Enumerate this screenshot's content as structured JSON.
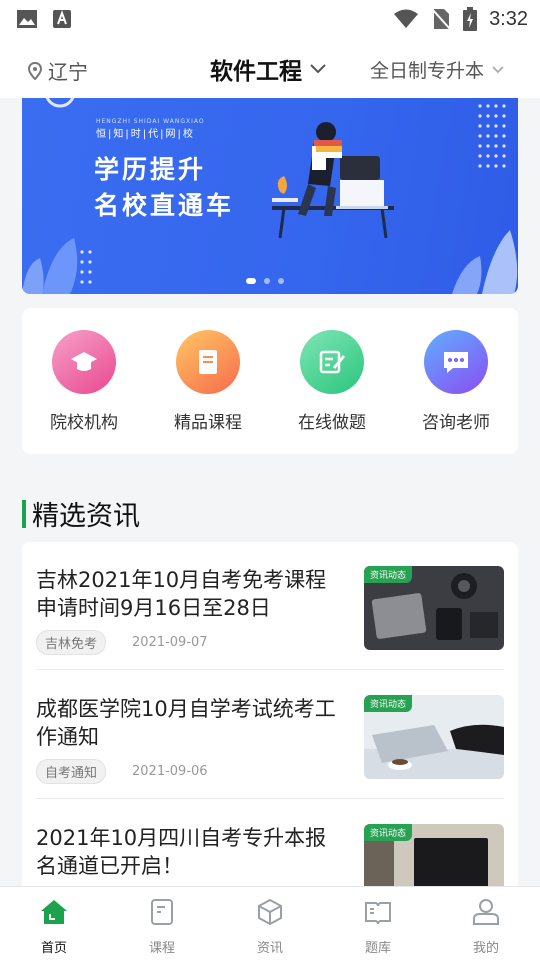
{
  "status": {
    "time": "3:32"
  },
  "header": {
    "location": "辽宁",
    "major": "软件工程",
    "education": "全日制专升本"
  },
  "banner": {
    "brand_en": "HENGZHI SHIDAI WANGXIAO",
    "brand": "恒|知|时|代|网|校",
    "title": "学历提升",
    "subtitle": "名校直通车",
    "page_count": 3,
    "active_page": 0
  },
  "quick_links": [
    {
      "label": "院校机构",
      "icon": "graduation-cap-icon",
      "color_from": "#f6a1c9",
      "color_to": "#e9488f"
    },
    {
      "label": "精品课程",
      "icon": "book-icon",
      "color_from": "#ffc765",
      "color_to": "#f66b4b"
    },
    {
      "label": "在线做题",
      "icon": "edit-note-icon",
      "color_from": "#7fe6b4",
      "color_to": "#2bc47d"
    },
    {
      "label": "咨询老师",
      "icon": "chat-icon",
      "color_from": "#5fb0ff",
      "color_to": "#8b4cf2"
    }
  ],
  "section": {
    "title": "精选资讯"
  },
  "news": [
    {
      "title": "吉林2021年10月自考免考课程申请时间9月16日至28日",
      "tag": "吉林免考",
      "date": "2021-09-07",
      "badge": "资讯动态",
      "thumb": "camera-desk-photo"
    },
    {
      "title": "成都医学院10月自学考试统考工作通知",
      "tag": "自考通知",
      "date": "2021-09-06",
      "badge": "资讯动态",
      "thumb": "laptop-coffee-photo"
    },
    {
      "title": "2021年10月四川自考专升本报名通道已开启！",
      "tag": "",
      "date": "",
      "badge": "资讯动态",
      "thumb": "office-monitor-photo"
    }
  ],
  "tabs": [
    {
      "label": "首页",
      "icon": "home-icon",
      "active": true
    },
    {
      "label": "课程",
      "icon": "course-icon",
      "active": false
    },
    {
      "label": "资讯",
      "icon": "news-box-icon",
      "active": false
    },
    {
      "label": "题库",
      "icon": "question-bank-icon",
      "active": false
    },
    {
      "label": "我的",
      "icon": "profile-icon",
      "active": false
    }
  ],
  "colors": {
    "accent": "#1aa34a",
    "banner": "#3566ee"
  }
}
